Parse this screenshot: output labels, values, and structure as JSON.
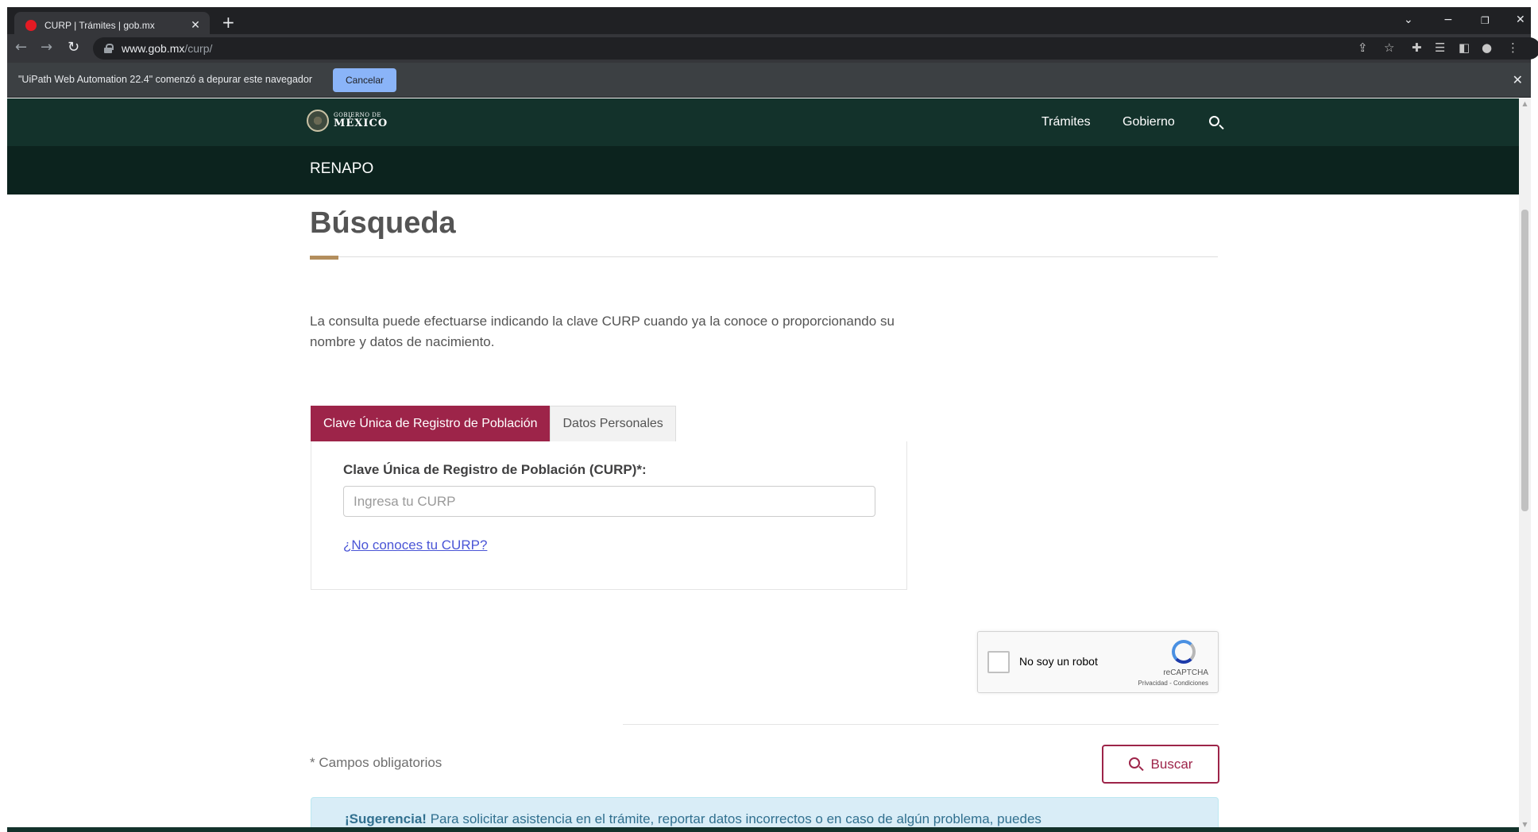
{
  "browser": {
    "tab_title": "CURP | Trámites | gob.mx",
    "tab_close": "✕",
    "new_tab": "+",
    "url_host": "www.gob.mx",
    "url_path": "/curp/",
    "icons": [
      "back-icon",
      "forward-icon",
      "reload-icon",
      "lock-icon",
      "share-icon",
      "star-icon",
      "extensions-icon",
      "reading-list-icon",
      "side-panel-icon",
      "profile-icon",
      "menu-icon"
    ]
  },
  "infobar": {
    "message": "\"UiPath Web Automation 22.4\" comenzó a depurar este navegador",
    "button_label": "Cancelar",
    "close": "✕"
  },
  "header": {
    "logo_small": "GOBIERNO DE",
    "logo_big": "MÉXICO",
    "nav": [
      "Trámites",
      "Gobierno"
    ],
    "subtitle": "RENAPO"
  },
  "main": {
    "title": "Búsqueda",
    "intro": "La consulta puede efectuarse indicando la clave CURP cuando ya la conoce o proporcionando su nombre y datos de nacimiento.",
    "tabs": [
      {
        "label": "Clave Única de Registro de Población",
        "active": true
      },
      {
        "label": "Datos Personales",
        "active": false
      }
    ],
    "field_label": "Clave Única de Registro de Población (CURP)*:",
    "field_placeholder": "Ingresa tu CURP",
    "field_value": "",
    "help_link": "¿No conoces tu CURP?",
    "captcha": {
      "label": "No soy un robot",
      "brand": "reCAPTCHA",
      "terms": "Privacidad - Condiciones"
    },
    "required_note": "* Campos obligatorios",
    "search_button": "Buscar",
    "alert_strong": "¡Sugerencia!",
    "alert_text": " Para solicitar asistencia en el trámite, reportar datos incorrectos o en caso de algún problema, puedes"
  },
  "colors": {
    "header_bg": "#13322b",
    "subheader_bg": "#0c231e",
    "accent_maroon": "#9d2449",
    "accent_gold": "#b38e5d",
    "alert_bg": "#d9edf7"
  }
}
